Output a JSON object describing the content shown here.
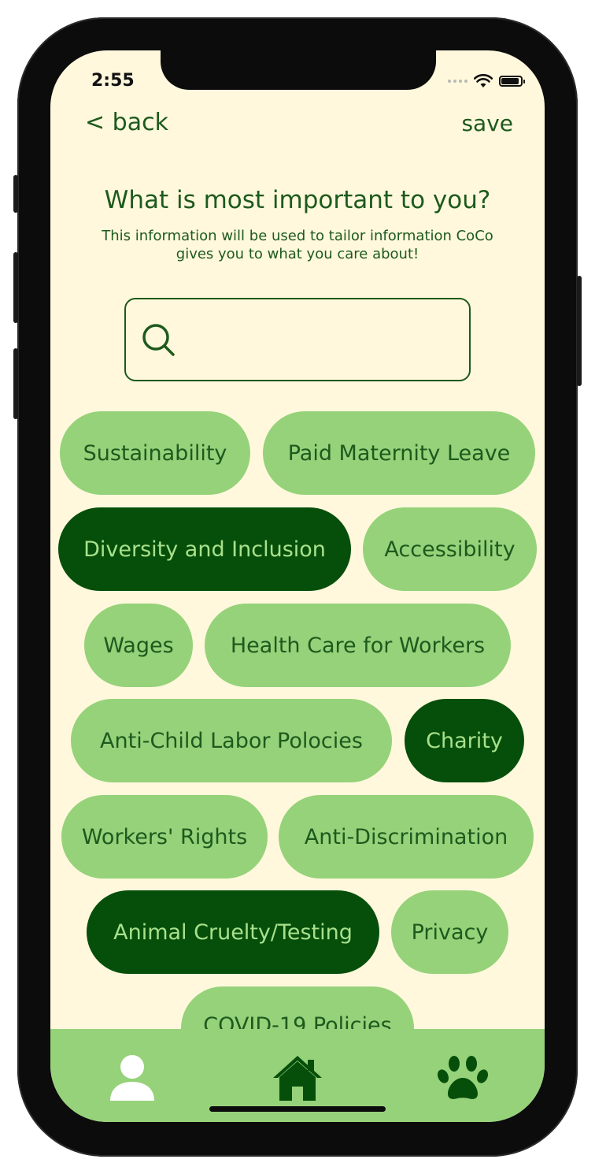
{
  "status_bar": {
    "time": "2:55"
  },
  "nav": {
    "back_label": "< back",
    "save_label": "save"
  },
  "header": {
    "title": "What is most important to you?",
    "subtitle": "This information will be used to tailor information CoCo gives you to what you care about!"
  },
  "search": {
    "value": "",
    "placeholder": "",
    "icon": "search-icon"
  },
  "tags": [
    {
      "label": "Sustainability",
      "selected": false
    },
    {
      "label": "Paid Maternity Leave",
      "selected": false
    },
    {
      "label": "Diversity and Inclusion",
      "selected": true
    },
    {
      "label": "Accessibility",
      "selected": false
    },
    {
      "label": "Wages",
      "selected": false
    },
    {
      "label": "Health Care for Workers",
      "selected": false
    },
    {
      "label": "Anti-Child Labor Polocies",
      "selected": false
    },
    {
      "label": "Charity",
      "selected": true
    },
    {
      "label": "Workers' Rights",
      "selected": false
    },
    {
      "label": "Anti-Discrimination",
      "selected": false
    },
    {
      "label": "Animal Cruelty/Testing",
      "selected": true
    },
    {
      "label": "Privacy",
      "selected": false
    },
    {
      "label": "COVID-19 Policies",
      "selected": false
    }
  ],
  "tab_bar": {
    "items": [
      {
        "icon": "profile-icon",
        "active": true
      },
      {
        "icon": "home-icon",
        "active": false
      },
      {
        "icon": "paw-icon",
        "active": false
      }
    ]
  },
  "colors": {
    "background": "#fff8dc",
    "primary": "#1d5a1d",
    "chip": "#96d27a",
    "chip_selected": "#064f0a",
    "chip_selected_text": "#a8e08c"
  }
}
